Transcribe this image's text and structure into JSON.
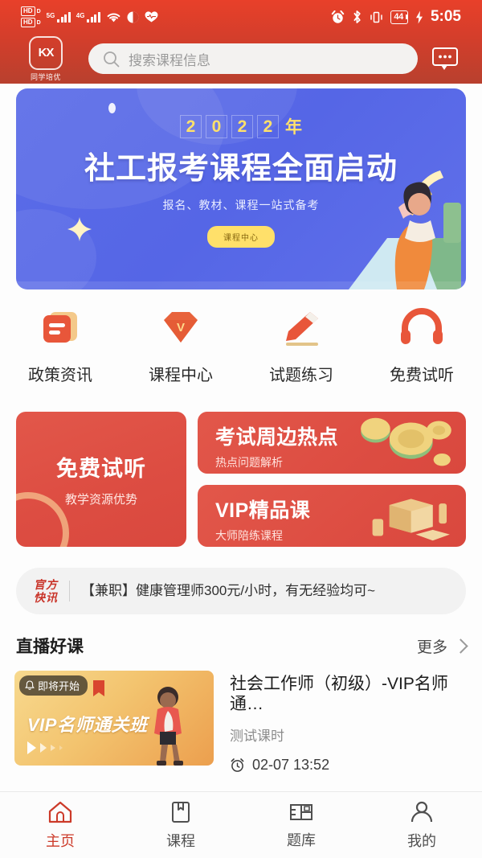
{
  "status_bar": {
    "hd_label": "HD",
    "hd_sub": "D",
    "net_5g": "5G",
    "net_4g": "4G",
    "icons": [
      "hd-dual-sim-icon",
      "signal-5g-icon",
      "signal-4g-icon",
      "wifi-icon",
      "do-not-disturb-icon",
      "heart-rate-icon",
      "alarm-icon",
      "bluetooth-icon",
      "vibrate-icon",
      "battery-icon",
      "charging-icon"
    ],
    "battery_level": "44",
    "time": "5:05"
  },
  "header": {
    "logo_mark": "KX",
    "logo_text": "同学培优",
    "search": {
      "placeholder": "搜索课程信息",
      "value": "",
      "icon": "search-icon"
    },
    "message_icon": "message-bubble-icon",
    "bg_color": "#d43e2b"
  },
  "banner": {
    "year_digits": [
      "2",
      "0",
      "2",
      "2"
    ],
    "year_suffix": "年",
    "title": "社工报考课程全面启动",
    "subtitle": "报名、教材、课程一站式备考",
    "button": "课程中心",
    "bg_color": "#5a6ae7",
    "accent_color": "#ffe06a"
  },
  "quick_nav": [
    {
      "label": "政策资讯",
      "icon": "news-document-icon"
    },
    {
      "label": "课程中心",
      "icon": "diamond-vip-icon"
    },
    {
      "label": "试题练习",
      "icon": "pencil-exam-icon"
    },
    {
      "label": "免费试听",
      "icon": "headphones-icon"
    }
  ],
  "promos": {
    "left": {
      "title": "免费试听",
      "subtitle": "教学资源优势"
    },
    "right": [
      {
        "title": "考试周边热点",
        "subtitle": "热点问题解析",
        "art": "coins-icon"
      },
      {
        "title": "VIP精品课",
        "subtitle": "大师陪练课程",
        "art": "boxes-icon"
      }
    ],
    "card_color": "#dd4d42"
  },
  "news": {
    "badge_line1": "官方",
    "badge_line2": "快讯",
    "text": "【兼职】健康管理师300元/小时，有无经验均可~"
  },
  "live_section": {
    "title": "直播好课",
    "more_label": "更多",
    "more_icon": "chevron-right-icon",
    "courses": [
      {
        "badge": "即将开始",
        "badge_icon": "bell-icon",
        "thumb_title": "VIP名师通关班",
        "title": "社会工作师（初级）-VIP名师通…",
        "subtitle": "测试课时",
        "time": "02-07 13:52",
        "time_icon": "alarm-clock-icon"
      }
    ]
  },
  "tab_bar": {
    "active_color": "#cc3a29",
    "items": [
      {
        "label": "主页",
        "icon": "home-icon",
        "active": true
      },
      {
        "label": "课程",
        "icon": "book-icon",
        "active": false
      },
      {
        "label": "题库",
        "icon": "question-bank-icon",
        "active": false
      },
      {
        "label": "我的",
        "icon": "person-icon",
        "active": false
      }
    ]
  }
}
